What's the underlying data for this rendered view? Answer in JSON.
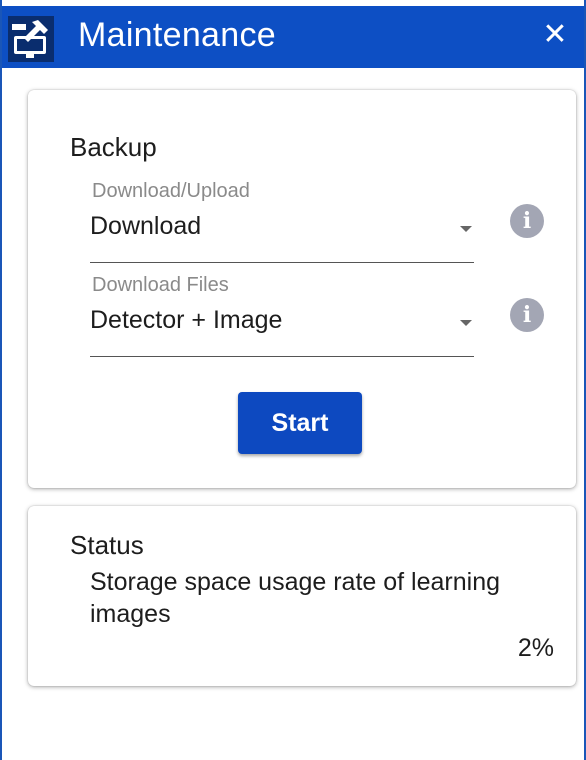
{
  "window": {
    "title": "Maintenance",
    "close_symbol": "✕"
  },
  "backup": {
    "title": "Backup",
    "direction": {
      "label": "Download/Upload",
      "value": "Download"
    },
    "files": {
      "label": "Download Files",
      "value": "Detector + Image"
    },
    "info_symbol": "i",
    "start_label": "Start"
  },
  "status": {
    "title": "Status",
    "storage_label": "Storage space usage rate of learning images",
    "storage_value": "2%"
  },
  "colors": {
    "titlebar": "#0d4fc4",
    "button": "#0d49c0",
    "info_icon": "#a3a6b4"
  },
  "icons": {
    "app": "wrench-monitor-icon",
    "close": "close-icon",
    "dropdown": "caret-down-icon",
    "info": "info-icon"
  }
}
